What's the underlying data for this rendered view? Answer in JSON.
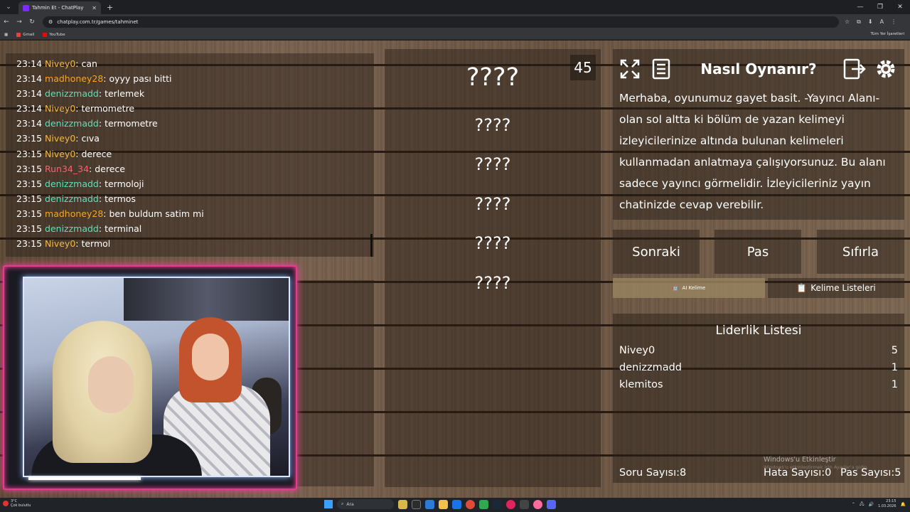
{
  "browser": {
    "tab_title": "Tahmin Et - ChatPlay",
    "url": "chatplay.com.tr/games/tahminet",
    "bookmarks": [
      "Gmail",
      "YouTube"
    ],
    "bookmarks_right": "Tüm Yer İşaretleri"
  },
  "chat": {
    "messages": [
      {
        "time": "23:14",
        "user": "Nivey0",
        "color": "#f0b84a",
        "text": "can"
      },
      {
        "time": "23:14",
        "user": "madhoney28",
        "color": "#f5a623",
        "text": "oyyy pası bitti"
      },
      {
        "time": "23:14",
        "user": "denizzmadd",
        "color": "#5ee0b8",
        "text": "terlemek"
      },
      {
        "time": "23:14",
        "user": "Nivey0",
        "color": "#f0b84a",
        "text": "termometre"
      },
      {
        "time": "23:14",
        "user": "denizzmadd",
        "color": "#5ee0b8",
        "text": "termometre"
      },
      {
        "time": "23:15",
        "user": "Nivey0",
        "color": "#f0b84a",
        "text": "cıva"
      },
      {
        "time": "23:15",
        "user": "Nivey0",
        "color": "#f0b84a",
        "text": "derece"
      },
      {
        "time": "23:15",
        "user": "Run34_34",
        "color": "#ff5f6b",
        "text": "derece"
      },
      {
        "time": "23:15",
        "user": "denizzmadd",
        "color": "#5ee0b8",
        "text": "termoloji"
      },
      {
        "time": "23:15",
        "user": "denizzmadd",
        "color": "#5ee0b8",
        "text": "termos"
      },
      {
        "time": "23:15",
        "user": "madhoney28",
        "color": "#f5a623",
        "text": "ben buldum satim mi"
      },
      {
        "time": "23:15",
        "user": "denizzmadd",
        "color": "#5ee0b8",
        "text": "terminal"
      },
      {
        "time": "23:15",
        "user": "Nivey0",
        "color": "#f0b84a",
        "text": "termol"
      }
    ]
  },
  "game": {
    "timer": "45",
    "main_word": "????",
    "forbidden_words": [
      "????",
      "????",
      "????",
      "????",
      "????"
    ]
  },
  "howto": {
    "title": "Nasıl Oynanır?",
    "text": "Merhaba, oyunumuz gayet basit. -Yayıncı Alanı- olan sol altta ki bölüm de yazan kelimeyi izleyicilerinize altında bulunan kelimeleri kullanmadan anlatmaya çalışıyorsunuz. Bu alanı sadece yayıncı görmelidir. İzleyicileriniz yayın chatinizde cevap verebilir."
  },
  "buttons": {
    "next": "Sonraki",
    "pass": "Pas",
    "reset": "Sıfırla",
    "ai_words": "AI Kelime",
    "word_lists": "Kelime Listeleri"
  },
  "leaderboard": {
    "title": "Liderlik Listesi",
    "rows": [
      {
        "name": "Nivey0",
        "score": "5"
      },
      {
        "name": "denizzmadd",
        "score": "1"
      },
      {
        "name": "klemitos",
        "score": "1"
      }
    ]
  },
  "stats": {
    "questions": "Soru Sayısı:8",
    "errors": "Hata Sayısı:0",
    "passes": "Pas Sayısı:5"
  },
  "watermark": {
    "line1": "Windows'u Etkinleştir",
    "line2": "Windows'u etkinleştirmek için Ayarlar'a gidin."
  },
  "taskbar": {
    "weather_temp": "3°C",
    "weather_desc": "Çok bulutlu",
    "search": "Ara",
    "time": "23:15",
    "date": "1.03.2026"
  },
  "colors": {
    "cam_border": "#e23d8d",
    "accent_ai": "#8a7a5a"
  }
}
